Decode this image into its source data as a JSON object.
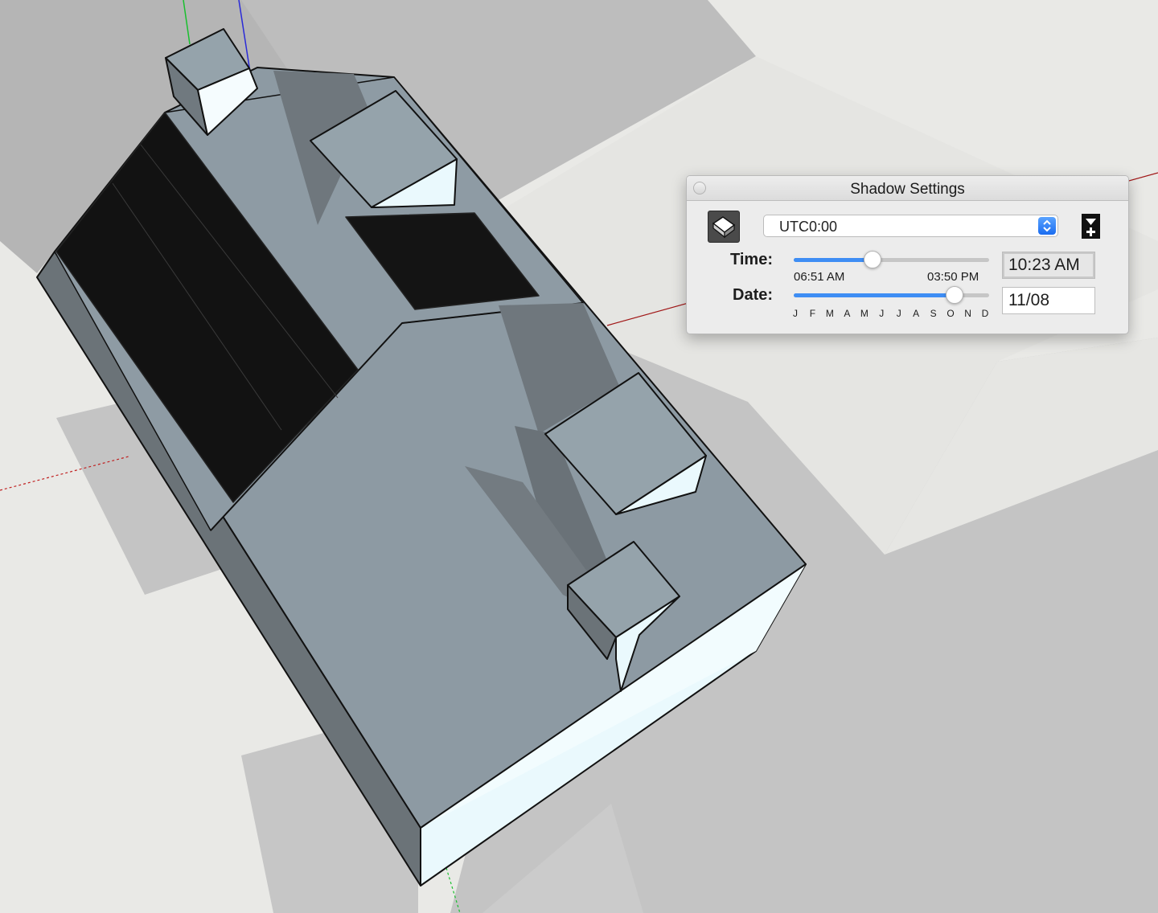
{
  "dialog": {
    "title": "Shadow Settings",
    "timezone": {
      "selected": "UTC0:00"
    },
    "time": {
      "label": "Time:",
      "start": "06:51 AM",
      "end": "03:50 PM",
      "value": "10:23 AM",
      "slider_fraction": 0.405
    },
    "date": {
      "label": "Date:",
      "value": "11/08",
      "slider_fraction": 0.825,
      "months": [
        "J",
        "F",
        "M",
        "A",
        "M",
        "J",
        "J",
        "A",
        "S",
        "O",
        "N",
        "D"
      ]
    }
  },
  "icons": {
    "toggle": "show-shadows-icon",
    "stepper": "up-down-stepper-icon",
    "expand": "expand-panel-icon"
  },
  "colors": {
    "accent": "#3e8df4",
    "roof": "#8d9aa3",
    "solar_panel": "#121212",
    "wall_lit": "#e8f8fd",
    "ground_shadow": "#c0c0c0"
  }
}
